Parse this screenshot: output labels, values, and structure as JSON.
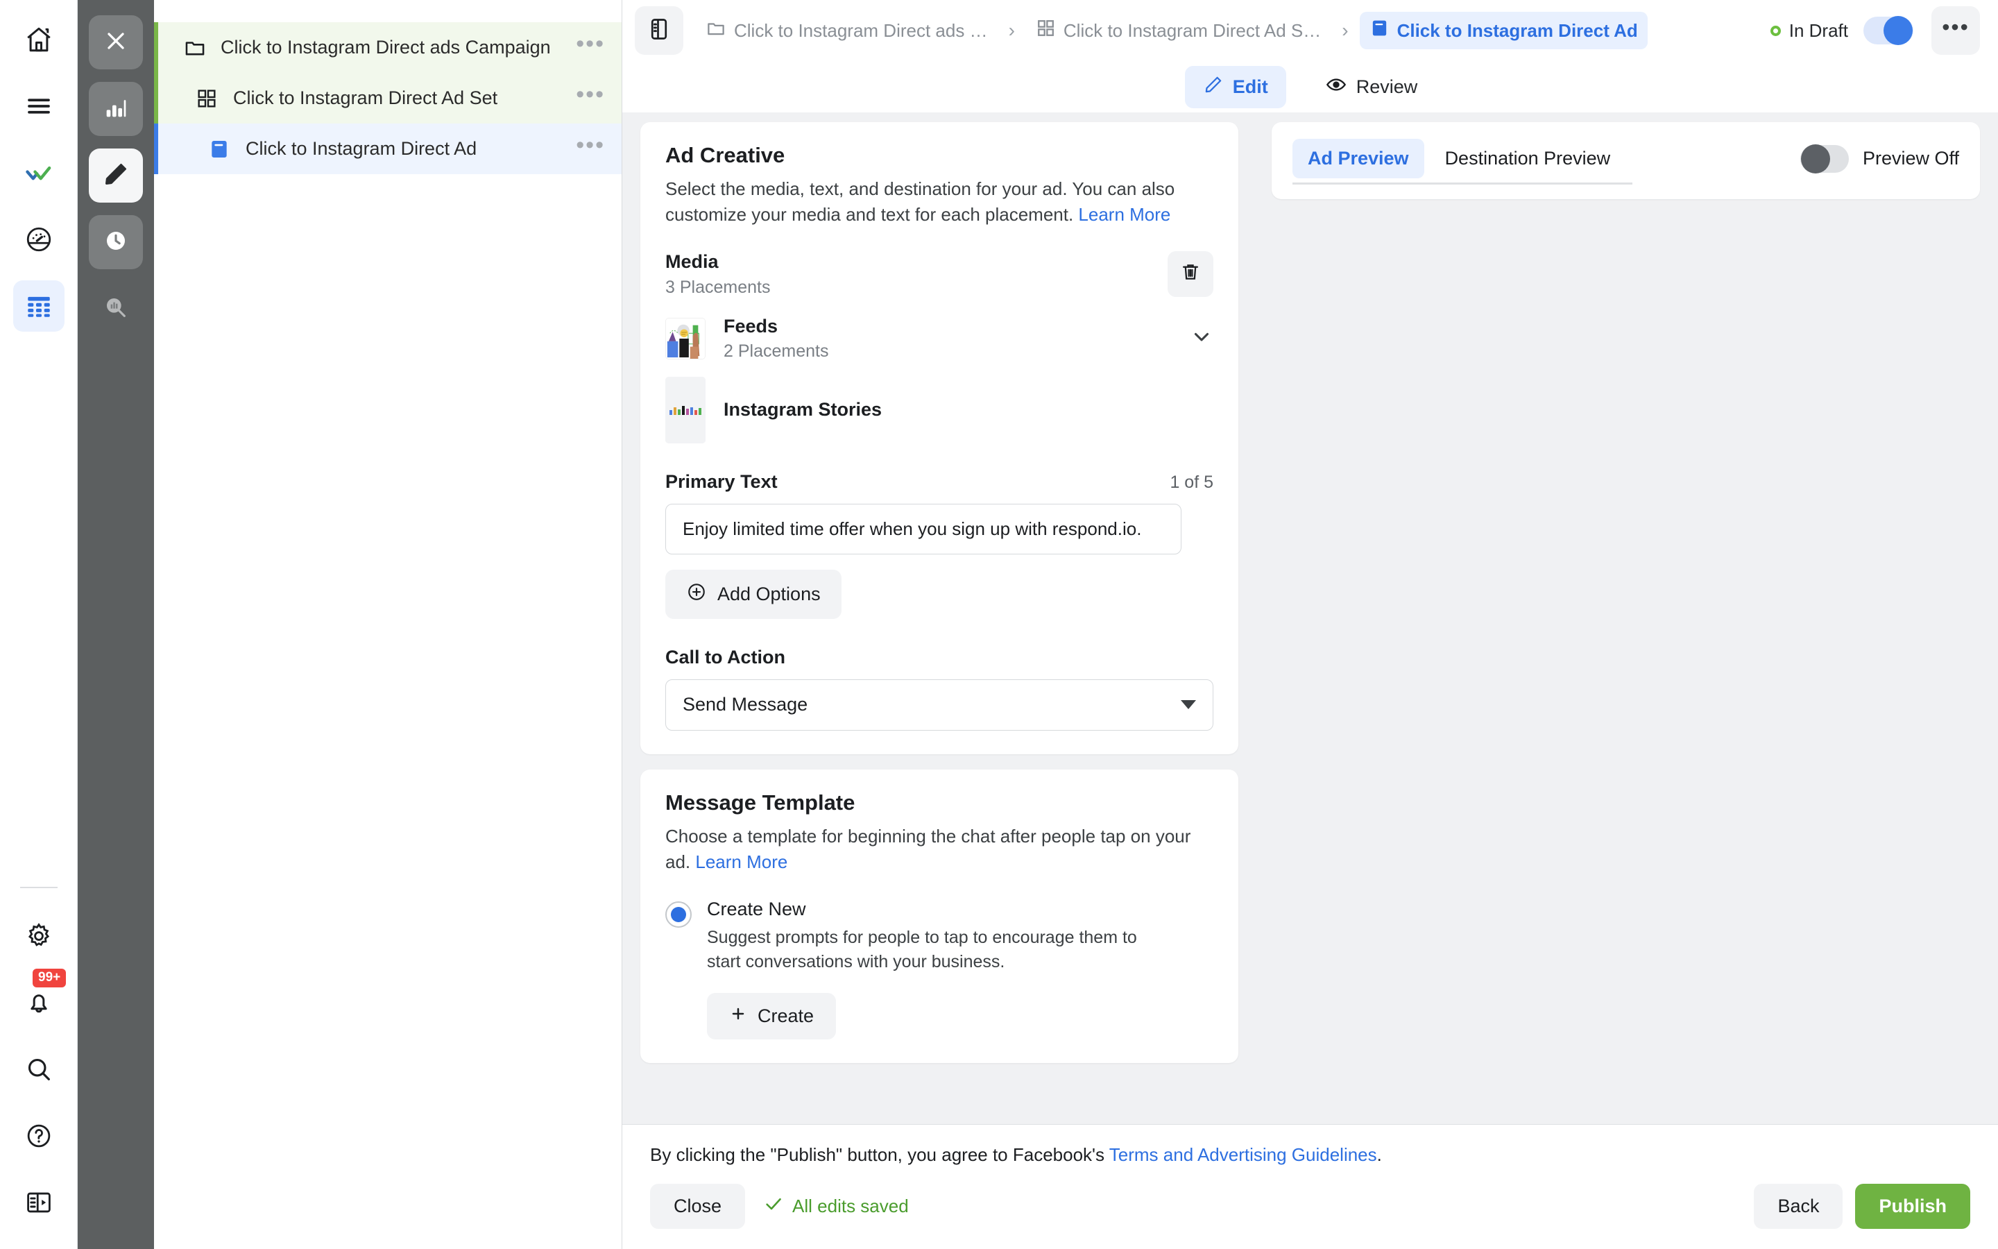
{
  "rail": {
    "top_items": [
      {
        "name": "home-icon",
        "label": "Home"
      },
      {
        "name": "menu-icon",
        "label": "Menu"
      },
      {
        "name": "respondio-logo-icon",
        "label": "respond.io"
      },
      {
        "name": "dashboard-icon",
        "label": "Dashboard"
      },
      {
        "name": "table-icon",
        "label": "Broadcasts",
        "active": true
      }
    ],
    "bottom_items": [
      {
        "name": "gear-icon",
        "label": "Settings"
      },
      {
        "name": "bell-icon",
        "label": "Notifications",
        "badge": "99+"
      },
      {
        "name": "search-icon",
        "label": "Search"
      },
      {
        "name": "help-icon",
        "label": "Help"
      },
      {
        "name": "panel-toggle-icon",
        "label": "Collapse panel"
      }
    ]
  },
  "dark_rail": {
    "items": [
      {
        "name": "close-icon",
        "label": "Close"
      },
      {
        "name": "bar-chart-icon",
        "label": "Performance"
      },
      {
        "name": "pencil-icon",
        "label": "Edit",
        "active": true
      },
      {
        "name": "clock-icon",
        "label": "History"
      },
      {
        "name": "chart-search-icon",
        "label": "Insights"
      }
    ]
  },
  "tree": {
    "items": [
      {
        "label": "Click to Instagram Direct ads Campaign",
        "icon": "folder-icon",
        "level": 0,
        "selected": false
      },
      {
        "label": "Click to Instagram Direct Ad Set",
        "icon": "grid-icon",
        "level": 1,
        "selected": false
      },
      {
        "label": "Click to Instagram Direct Ad",
        "icon": "ad-icon",
        "level": 2,
        "selected": true
      }
    ],
    "row_menu_label": "•••"
  },
  "topbar": {
    "panel_icon": "sidebar-panel-icon",
    "breadcrumbs": [
      {
        "label": "Click to Instagram Direct ads …",
        "icon": "folder-icon",
        "active": false
      },
      {
        "label": "Click to Instagram Direct Ad S…",
        "icon": "grid-icon",
        "active": false
      },
      {
        "label": "Click to Instagram Direct Ad",
        "icon": "ad-icon",
        "active": true
      }
    ],
    "separator": "›",
    "status_label": "In Draft",
    "status_color": "#6cbf3f",
    "toggle_on": true,
    "more_label": "•••"
  },
  "tabs": [
    {
      "label": "Edit",
      "icon": "pencil-icon",
      "active": true
    },
    {
      "label": "Review",
      "icon": "eye-icon",
      "active": false
    }
  ],
  "ad_creative": {
    "title": "Ad Creative",
    "description": "Select the media, text, and destination for your ad. You can also customize your media and text for each placement.",
    "learn_more": "Learn More",
    "media": {
      "title": "Media",
      "subtitle": "3 Placements",
      "delete_icon": "trash-icon",
      "placements": [
        {
          "name": "Feeds",
          "subtitle": "2 Placements",
          "chevron": "chevron-down-icon"
        },
        {
          "name": "Instagram Stories",
          "subtitle": ""
        }
      ]
    },
    "primary_text": {
      "label": "Primary Text",
      "counter": "1 of 5",
      "value": "Enjoy limited time offer when you sign up with respond.io.",
      "add_options_label": "Add Options"
    },
    "call_to_action": {
      "label": "Call to Action",
      "value": "Send Message"
    }
  },
  "message_template": {
    "title": "Message Template",
    "description": "Choose a template for beginning the chat after people tap on your ad.",
    "learn_more": "Learn More",
    "option": {
      "title": "Create New",
      "description": "Suggest prompts for people to tap to encourage them to start conversations with your business.",
      "selected": true
    },
    "create_label": "Create"
  },
  "preview": {
    "tabs": [
      {
        "label": "Ad Preview",
        "active": true
      },
      {
        "label": "Destination Preview",
        "active": false
      }
    ],
    "toggle_label": "Preview Off",
    "toggle_on": false
  },
  "footer": {
    "tos_prefix": "By clicking the \"Publish\" button, you agree to Facebook's ",
    "tos_link": "Terms and Advertising Guidelines",
    "tos_suffix": ".",
    "close_label": "Close",
    "saved_label": "All edits saved",
    "back_label": "Back",
    "publish_label": "Publish"
  },
  "colors": {
    "accent_blue": "#2d6fe0",
    "green": "#6fb342",
    "draft_green": "#6cbf3f",
    "red_badge": "#f0443e"
  }
}
